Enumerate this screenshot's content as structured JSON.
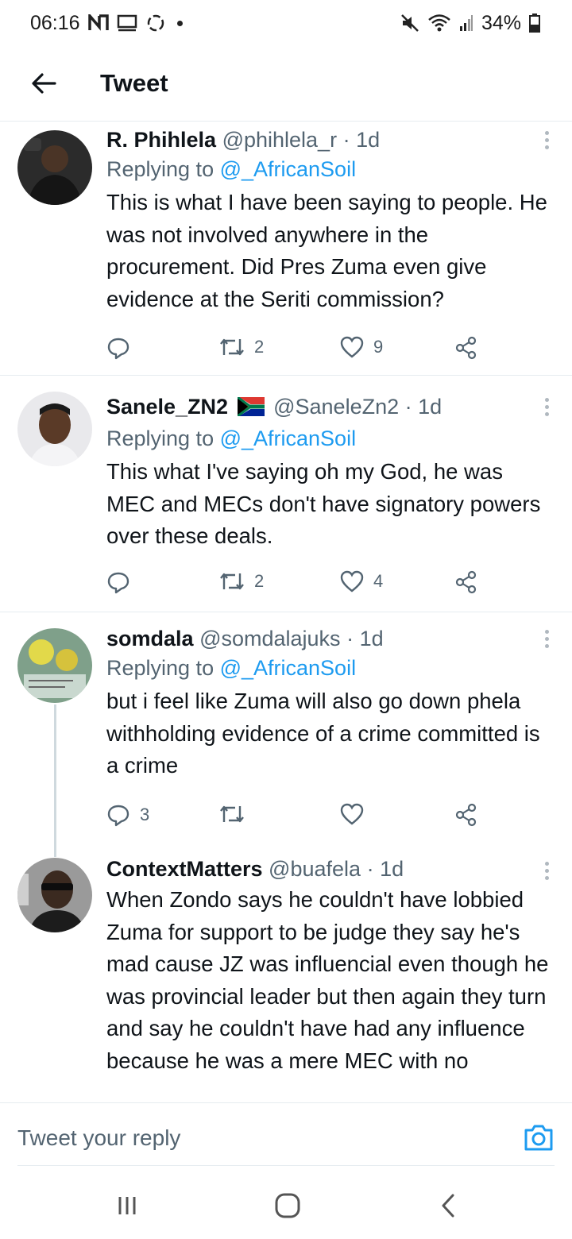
{
  "status_bar": {
    "time": "06:16",
    "battery": "34%",
    "icons": [
      "n-icon",
      "screen-icon",
      "sync-icon",
      "mute-icon",
      "wifi-icon",
      "signal-icon",
      "battery-icon"
    ]
  },
  "header": {
    "title": "Tweet"
  },
  "tweets": [
    {
      "name": "R. Phihlela",
      "handle": "@phihlela_r",
      "time": "1d",
      "replying_prefix": "Replying to ",
      "replying_to": "@_AfricanSoil",
      "text": "This is what I have been saying to people. He was not involved anywhere in the procurement. Did Pres Zuma even give evidence at the Seriti commission?",
      "replies": "",
      "retweets": "2",
      "likes": "9"
    },
    {
      "name": "Sanele_ZN2",
      "handle": "@SaneleZn2",
      "time": "1d",
      "replying_prefix": "Replying to ",
      "replying_to": "@_AfricanSoil",
      "text": "This what I've saying oh my God, he was MEC and MECs don't have signatory powers over these deals.",
      "replies": "",
      "retweets": "2",
      "likes": "4"
    },
    {
      "name": "somdala",
      "handle": "@somdalajuks",
      "time": "1d",
      "replying_prefix": "Replying to ",
      "replying_to": "@_AfricanSoil",
      "text": "but i feel like Zuma will also go down phela withholding evidence of a crime committed is a crime",
      "replies": "3",
      "retweets": "",
      "likes": ""
    },
    {
      "name": "ContextMatters",
      "handle": "@buafela",
      "time": "1d",
      "text": "When Zondo says he couldn't have lobbied Zuma for support to be judge they say he's mad cause JZ was influencial even though he was provincial leader but then again they turn and say he couldn't have had any influence because he was a mere MEC with no"
    }
  ],
  "reply_bar": {
    "placeholder": "Tweet your reply"
  },
  "colors": {
    "accent": "#1d9bf0",
    "secondary_text": "#536471",
    "primary_text": "#0f1419"
  }
}
